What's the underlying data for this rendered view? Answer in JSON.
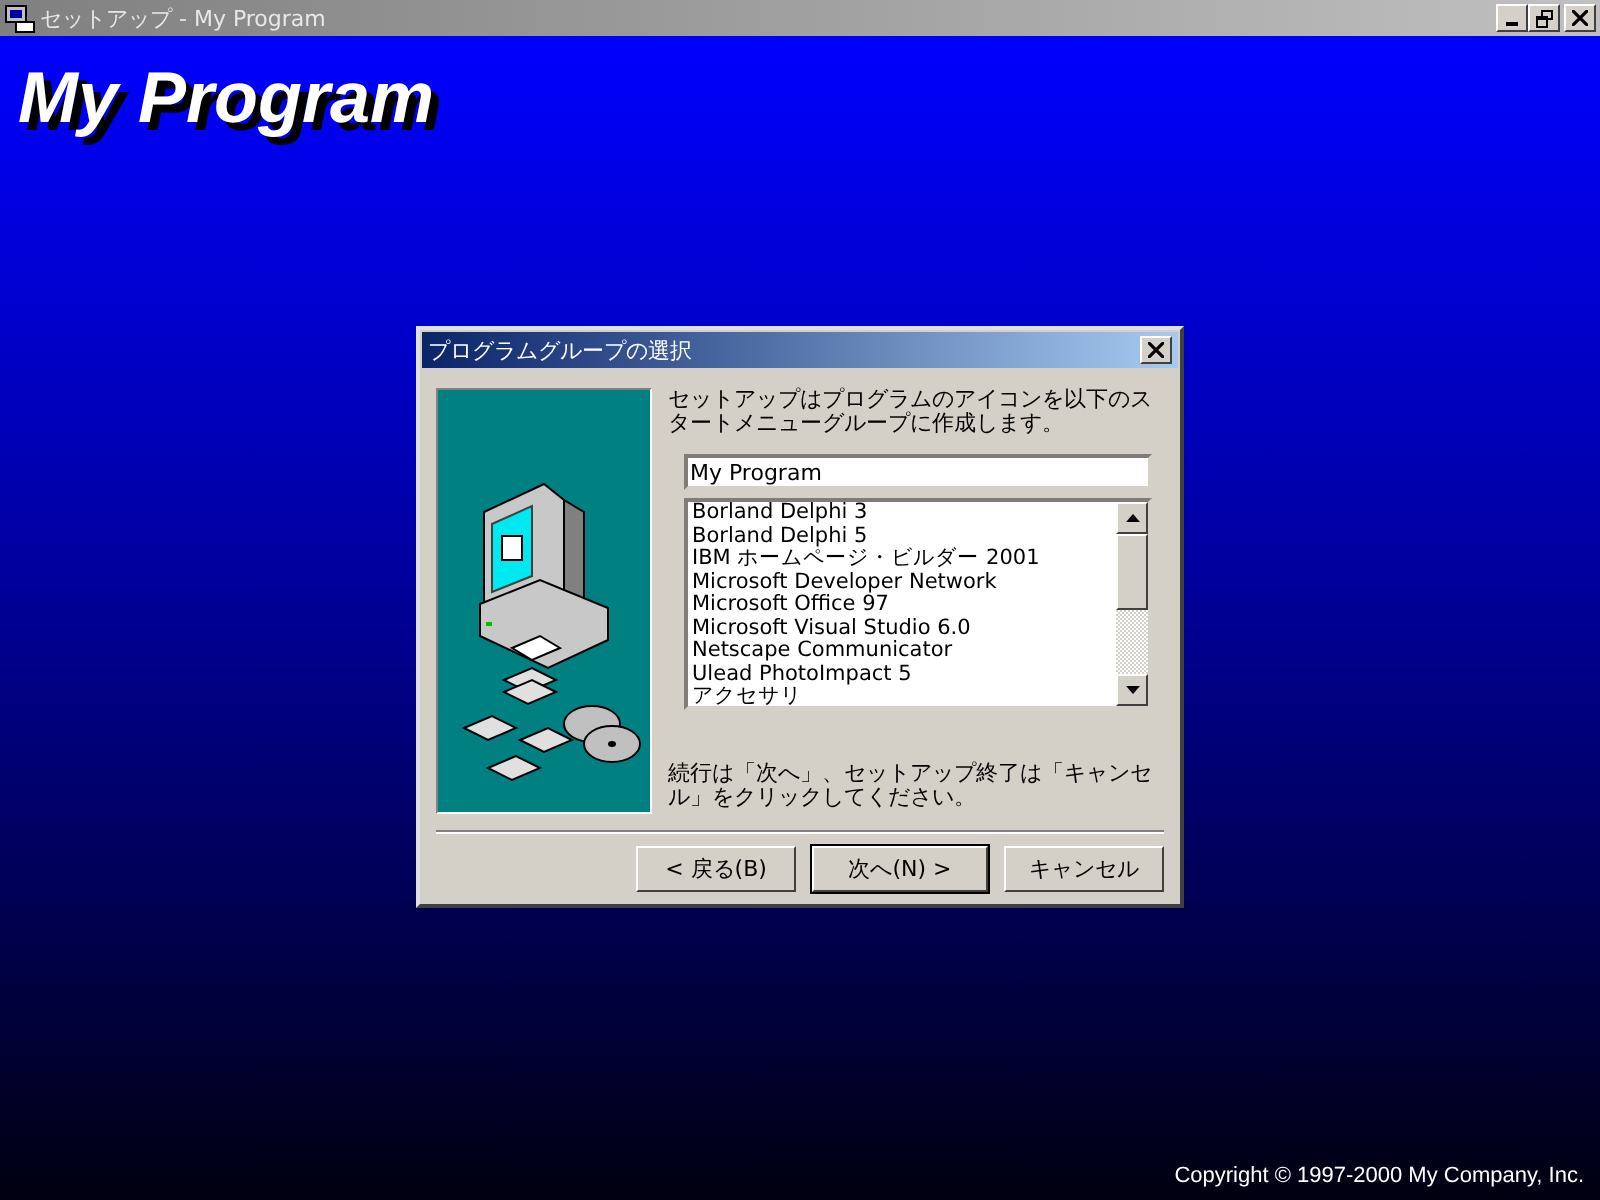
{
  "window": {
    "title": "セットアップ - My Program"
  },
  "banner": {
    "title": "My Program"
  },
  "dialog": {
    "title": "プログラムグループの選択",
    "description": "セットアップはプログラムのアイコンを以下のスタートメニューグループに作成します。",
    "group_name": "My Program",
    "program_groups": [
      "Borland Delphi 3",
      "Borland Delphi 5",
      "IBM ホームページ・ビルダー 2001",
      "Microsoft Developer Network",
      "Microsoft Office 97",
      "Microsoft Visual Studio 6.0",
      "Netscape Communicator",
      "Ulead PhotoImpact 5",
      "アクセサリ"
    ],
    "instruction": "続行は「次へ」、セットアップ終了は「キャンセル」をクリックしてください。",
    "buttons": [
      {
        "label": "< 戻る(B)",
        "default": false
      },
      {
        "label": "次へ(N) >",
        "default": true
      },
      {
        "label": "キャンセル",
        "default": false
      }
    ]
  },
  "copyright": "Copyright © 1997-2000 My Company, Inc."
}
